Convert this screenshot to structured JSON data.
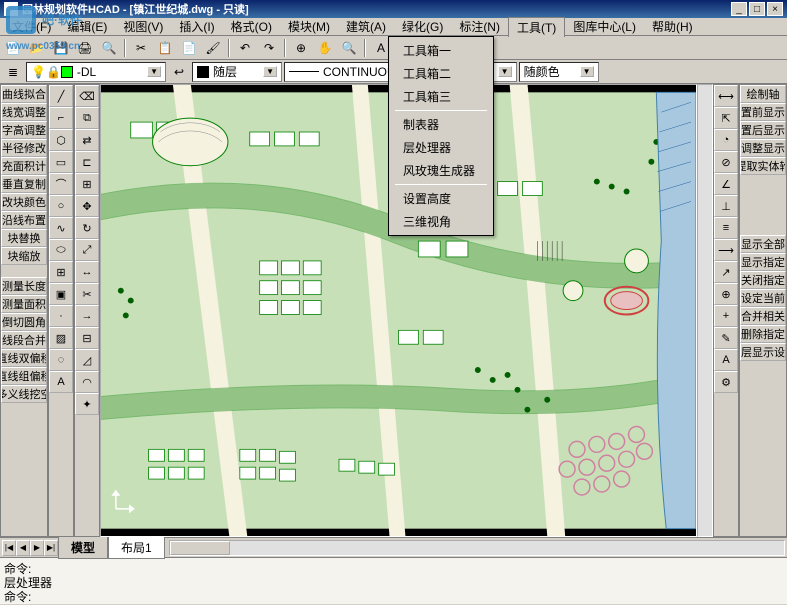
{
  "title": "园林规划软件HCAD - [镇江世纪城.dwg - 只读]",
  "watermark_url": "www.pc0359.cn",
  "menubar": [
    {
      "label": "文件(F)",
      "key": "F"
    },
    {
      "label": "编辑(E)",
      "key": "E"
    },
    {
      "label": "视图(V)",
      "key": "V"
    },
    {
      "label": "插入(I)",
      "key": "I"
    },
    {
      "label": "格式(O)",
      "key": "O"
    },
    {
      "label": "模块(M)",
      "key": "M"
    },
    {
      "label": "建筑(A)",
      "key": "A"
    },
    {
      "label": "绿化(G)",
      "key": "G"
    },
    {
      "label": "标注(N)",
      "key": "N"
    },
    {
      "label": "工具(T)",
      "key": "T"
    },
    {
      "label": "图库中心(L)",
      "key": "L"
    },
    {
      "label": "帮助(H)",
      "key": "H"
    }
  ],
  "dropdown_menu": {
    "groups": [
      [
        "工具箱一",
        "工具箱二",
        "工具箱三"
      ],
      [
        "制表器",
        "层处理器",
        "风玫瑰生成器"
      ],
      [
        "设置高度",
        "三维视角"
      ]
    ]
  },
  "layer_dropdown": {
    "value": "-DL",
    "icon_color": "#00ff00"
  },
  "style_dropdown": {
    "value": "随层",
    "swatch": "#000000"
  },
  "linetype_dropdown": {
    "value": "CONTINUOU"
  },
  "color_dropdown": {
    "value": "随颜色"
  },
  "left_panel_1": [
    "曲线拟合",
    "线宽调整",
    "字高调整",
    "半径修改",
    "填充面积计算",
    "垂直复制",
    "改块颜色",
    "沿线布置",
    "块替换",
    "块缩放"
  ],
  "left_panel_2": [
    "测量长度",
    "测量面积",
    "倒切圆角",
    "线段合并",
    "直线双偏移",
    "直线组偏移",
    "多义线挖空"
  ],
  "right_panel_1": [
    "绘制轴",
    "置前显示",
    "置后显示",
    "调整显示",
    "提取实体轮"
  ],
  "right_panel_2": [
    "显示全部",
    "显示指定",
    "关闭指定",
    "设定当前",
    "合并相关",
    "删除指定",
    "层显示设"
  ],
  "tabs": {
    "items": [
      "模型",
      "布局1"
    ],
    "active": 0
  },
  "command": {
    "line1": "命令:",
    "line2": "层处理器",
    "prompt": "命令:"
  },
  "colors": {
    "green": "#00a000",
    "light_green": "#7cc47c",
    "dark_green": "#005000",
    "road": "#f8f8f0",
    "red": "#d04040"
  }
}
